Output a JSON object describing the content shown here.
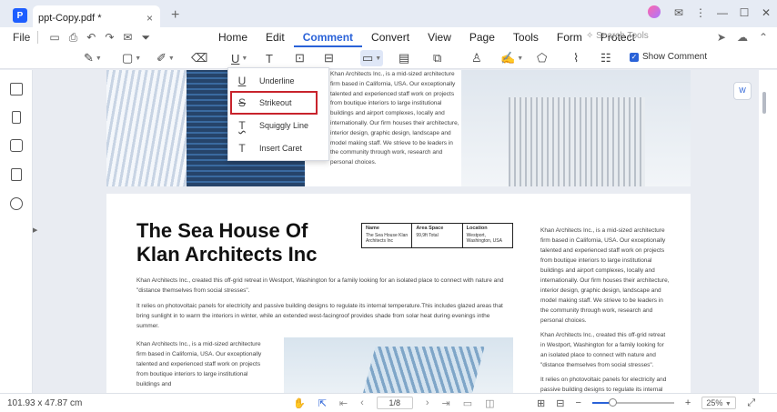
{
  "titlebar": {
    "tab_title": "ppt-Copy.pdf *",
    "close": "×",
    "new_tab": "+",
    "win_controls": [
      "⋮",
      "—",
      "☐",
      "✕"
    ]
  },
  "menubar": {
    "file": "File",
    "menus": [
      "Home",
      "Edit",
      "Comment",
      "Convert",
      "View",
      "Page",
      "Tools",
      "Form",
      "Protect"
    ],
    "active_menu": "Comment",
    "search_tools": "Search Tools"
  },
  "toolbar": {
    "show_comment_label": "Show Comment",
    "show_comment_checked": true
  },
  "dropdown": {
    "items": [
      {
        "label": "Underline",
        "icon": "U"
      },
      {
        "label": "Strikeout",
        "icon": "S"
      },
      {
        "label": "Squiggly Line",
        "icon": "T"
      },
      {
        "label": "Insert Caret",
        "icon": "T"
      }
    ],
    "highlighted": "Strikeout"
  },
  "page1": {
    "text": "Khan Architects Inc., is a mid-sized architecture firm based in California, USA. Our exceptionally talented and experienced staff work on projects from boutique interiors to large institutional buildings and airport complexes, locally and internationally. Our firm houses their architecture, interior design, graphic design, landscape and model making staff. We strieve to be leaders in the community through work, research and personal choices."
  },
  "page2": {
    "title_line1": "The Sea House Of",
    "title_line2": "Klan Architects Inc",
    "info": {
      "name_label": "Name",
      "name_value": "The Sea House Klan Architects Inc",
      "area_label": "Area Space",
      "area_value": "99,9ft Total",
      "location_label": "Location",
      "location_value": "Westport, Washington, USA"
    },
    "para1": "Khan Architects Inc., created this off-grid retreat in Westport, Washington for a family looking for an isolated place to connect with nature and \"distance themselves from social stresses\".",
    "para2": "It relies on photovoltaic panels for electricity and passive building designs to regulate its internal temperature.This includes glazed areas that bring sunlight in to warm the interiors in winter, while an extended west-facingroof provides shade from solar heat during evenings inthe summer.",
    "right_col1": "Khan Architects Inc., is a mid-sized architecture firm based in California, USA. Our exceptionally talented and experienced staff work on projects from boutique interiors to large institutional buildings and airport complexes, locally and internationally. Our firm houses their architecture, interior design, graphic design, landscape and model making staff. We strieve to be leaders in the community through work, research and personal choices.",
    "right_col2": "Khan Architects Inc., created this off-grid retreat in Westport, Washington for a family looking for an isolated place to connect with nature and \"distance themselves from social stresses\".",
    "right_col3": "It relies on photovoltaic panels for electricity and passive building designs to regulate its internal temperature.This includes glazed areas that bring",
    "bottom_col": "Khan Architects Inc., is a mid-sized architecture firm based in California, USA. Our exceptionally talented and experienced staff work on projects from boutique interiors to large institutional buildings and"
  },
  "statusbar": {
    "dimensions": "101.93 x 47.87 cm",
    "page_indicator": "1/8",
    "zoom": "25%",
    "zoom_fraction": 0.25
  }
}
